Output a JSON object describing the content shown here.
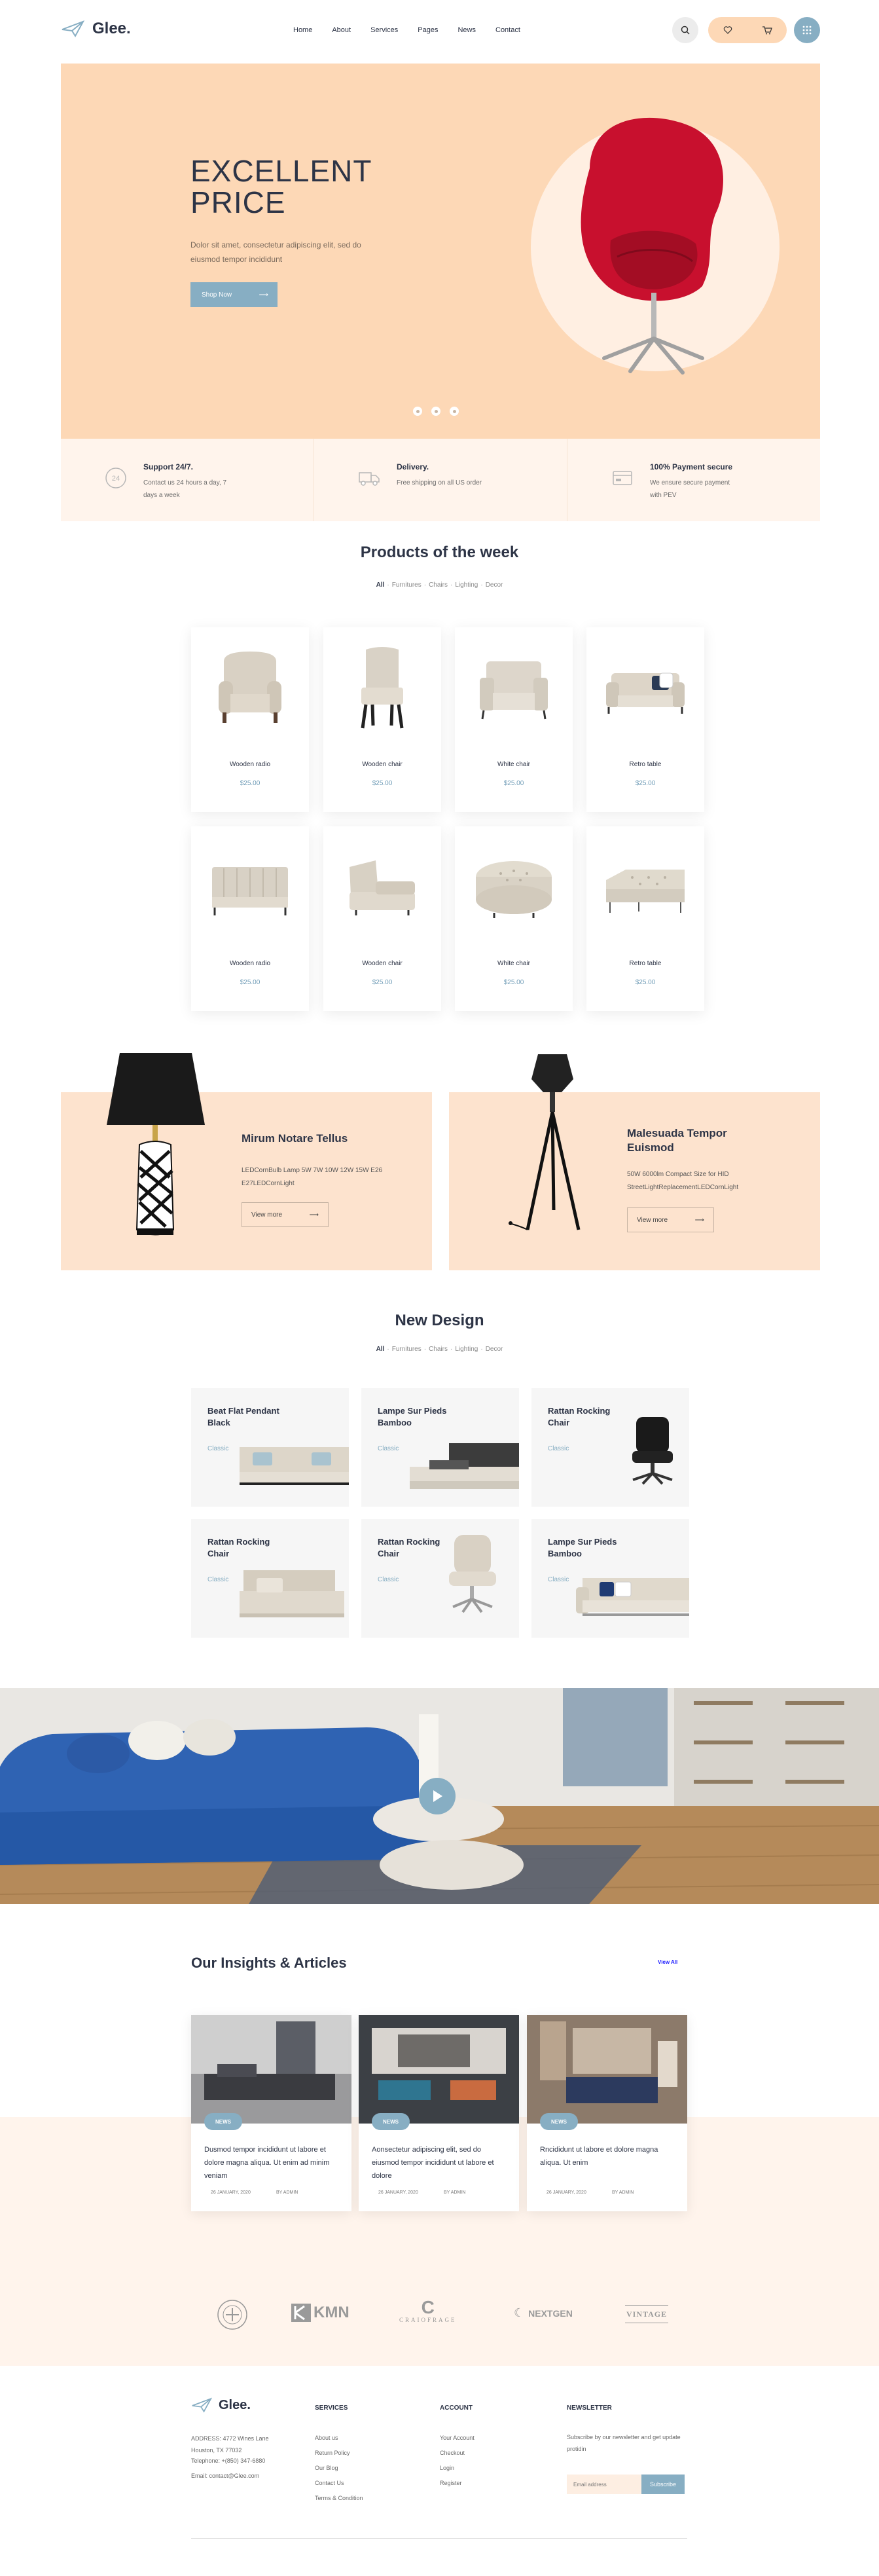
{
  "header": {
    "logo_text": "Glee.",
    "nav": [
      "Home",
      "About",
      "Services",
      "Pages",
      "News",
      "Contact"
    ]
  },
  "hero": {
    "title_line1": "EXCELLENT",
    "title_line2": "PRICE",
    "subtitle": "Dolor sit amet, consectetur adipiscing elit, sed do eiusmod tempor incididunt",
    "button": "Shop Now"
  },
  "features": [
    {
      "icon": "support-24-icon",
      "title": "Support 24/7.",
      "text": "Contact us 24 hours a day, 7 days a week"
    },
    {
      "icon": "delivery-truck-icon",
      "title": "Delivery.",
      "text": "Free shipping on all US order"
    },
    {
      "icon": "payment-card-icon",
      "title": "100% Payment secure",
      "text": "We ensure secure payment with PEV"
    }
  ],
  "products": {
    "title": "Products of the week",
    "filters": [
      "All",
      "Furnitures",
      "Chairs",
      "Lighting",
      "Decor"
    ],
    "items": [
      {
        "name": "Wooden radio",
        "price": "$25.00"
      },
      {
        "name": "Wooden chair",
        "price": "$25.00"
      },
      {
        "name": "White chair",
        "price": "$25.00"
      },
      {
        "name": "Retro table",
        "price": "$25.00"
      },
      {
        "name": "Wooden radio",
        "price": "$25.00"
      },
      {
        "name": "Wooden chair",
        "price": "$25.00"
      },
      {
        "name": "White chair",
        "price": "$25.00"
      },
      {
        "name": "Retro table",
        "price": "$25.00"
      }
    ]
  },
  "promos": [
    {
      "title": "Mirum Notare Tellus",
      "text": "LEDCornBulb Lamp 5W 7W 10W 12W 15W E26 E27LEDCornLight",
      "button": "View more"
    },
    {
      "title": "Malesuada Tempor Euismod",
      "text": "50W 6000lm Compact Size for HID StreetLightReplacementLEDCornLight",
      "button": "View more"
    }
  ],
  "new_design": {
    "title": "New Design",
    "filters": [
      "All",
      "Furnitures",
      "Chairs",
      "Lighting",
      "Decor"
    ],
    "items": [
      {
        "title": "Beat Flat Pendant Black",
        "category": "Classic"
      },
      {
        "title": "Lampe Sur Pieds Bamboo",
        "category": "Classic"
      },
      {
        "title": "Rattan Rocking Chair",
        "category": "Classic"
      },
      {
        "title": "Rattan Rocking Chair",
        "category": "Classic"
      },
      {
        "title": "Rattan Rocking Chair",
        "category": "Classic"
      },
      {
        "title": "Lampe Sur Pieds Bamboo",
        "category": "Classic"
      }
    ]
  },
  "articles": {
    "title": "Our Insights & Articles",
    "view_all": "View All",
    "items": [
      {
        "badge": "NEWS",
        "text": "Dusmod tempor incididunt ut labore et dolore magna aliqua. Ut enim ad minim veniam",
        "date": "26 JANUARY, 2020",
        "author": "BY ADMIN"
      },
      {
        "badge": "NEWS",
        "text": "Aonsectetur adipiscing elit, sed do eiusmod tempor incididunt ut labore et dolore",
        "date": "26 JANUARY, 2020",
        "author": "BY ADMIN"
      },
      {
        "badge": "NEWS",
        "text": "Rncididunt ut labore et dolore magna aliqua. Ut enim",
        "date": "26 JANUARY, 2020",
        "author": "BY ADMIN"
      }
    ]
  },
  "brands": [
    "KMN",
    "CRAIOFRAGE",
    "NEXTGEN",
    "VINTAGE"
  ],
  "footer": {
    "logo_text": "Glee.",
    "address": "ADDRESS: 4772 Wines Lane Houston, TX 77032",
    "telephone": "Telephone: +(850) 347-6880",
    "email": "Email: contact@Glee.com",
    "services_title": "SERVICES",
    "services": [
      "About us",
      "Return Policy",
      "Our Blog",
      "Contact Us",
      "Terms & Condition"
    ],
    "account_title": "ACCOUNT",
    "account": [
      "Your Account",
      "Checkout",
      "Login",
      "Register"
    ],
    "newsletter_title": "NEWSLETTER",
    "newsletter_text": "Subscribe by our newsletter and get update protidin",
    "email_placeholder": "Email address",
    "subscribe": "Subscribe"
  },
  "colors": {
    "accent": "#87aec3",
    "hero_bg": "#fdd8b6",
    "light_peach": "#fff4ec",
    "chair_red": "#c8102e"
  }
}
